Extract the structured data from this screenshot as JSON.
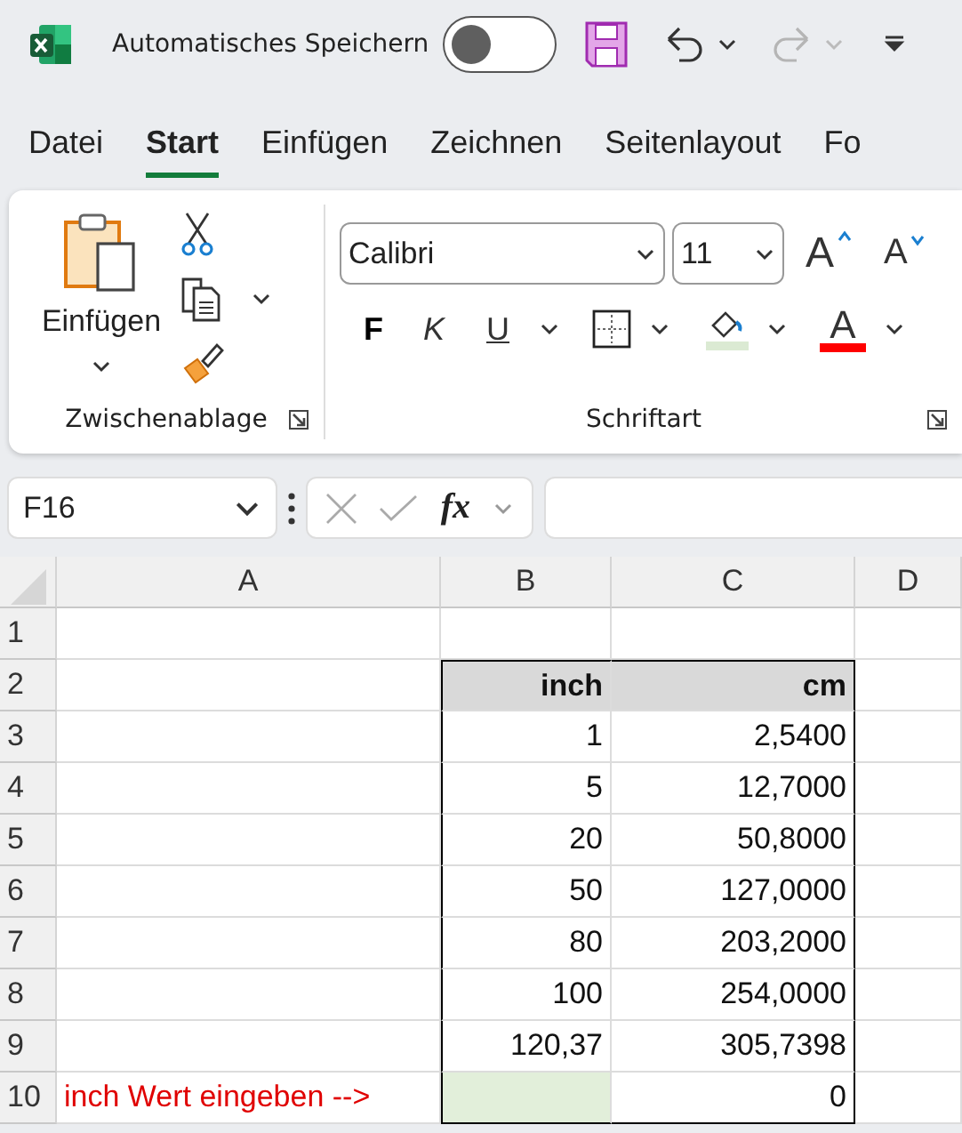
{
  "title_bar": {
    "autosave_label": "Automatisches Speichern",
    "autosave_on": false,
    "redo_disabled": true
  },
  "tabs": [
    {
      "label": "Datei",
      "selected": false
    },
    {
      "label": "Start",
      "selected": true
    },
    {
      "label": "Einfügen",
      "selected": false
    },
    {
      "label": "Zeichnen",
      "selected": false
    },
    {
      "label": "Seitenlayout",
      "selected": false
    },
    {
      "label": "Fo",
      "selected": false
    }
  ],
  "ribbon": {
    "clipboard": {
      "paste_label": "Einfügen",
      "group_label": "Zwischenablage"
    },
    "font": {
      "font_name": "Calibri",
      "font_size": "11",
      "grow_label": "A",
      "shrink_label": "A",
      "bold_label": "F",
      "italic_label": "K",
      "underline_label": "U",
      "font_color_label": "A",
      "group_label": "Schriftart"
    }
  },
  "formula_bar": {
    "name_box": "F16",
    "fx_label": "fx"
  },
  "sheet": {
    "columns": [
      "A",
      "B",
      "C",
      "D"
    ],
    "rows": [
      {
        "label": "1",
        "boxed": false
      },
      {
        "label": "2",
        "b": "inch",
        "c": "cm",
        "header": true,
        "boxed": true
      },
      {
        "label": "3",
        "b": "1",
        "c": "2,5400",
        "boxed": true
      },
      {
        "label": "4",
        "b": "5",
        "c": "12,7000",
        "boxed": true
      },
      {
        "label": "5",
        "b": "20",
        "c": "50,8000",
        "boxed": true
      },
      {
        "label": "6",
        "b": "50",
        "c": "127,0000",
        "boxed": true
      },
      {
        "label": "7",
        "b": "80",
        "c": "203,2000",
        "boxed": true
      },
      {
        "label": "8",
        "b": "100",
        "c": "254,0000",
        "boxed": true
      },
      {
        "label": "9",
        "b": "120,37",
        "c": "305,7398",
        "boxed": true
      },
      {
        "label": "10",
        "a": "inch Wert eingeben -->",
        "b_input": true,
        "c": "0",
        "boxed": true
      }
    ]
  }
}
